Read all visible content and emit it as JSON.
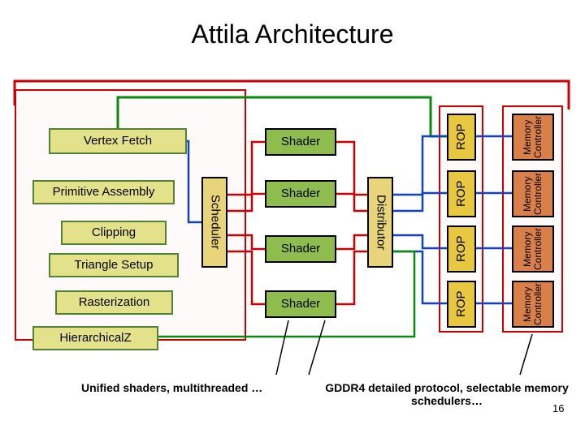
{
  "title": "Attila Architecture",
  "pipeline": {
    "vertex_fetch": "Vertex Fetch",
    "primitive_assembly": "Primitive Assembly",
    "clipping": "Clipping",
    "triangle_setup": "Triangle Setup",
    "rasterization": "Rasterization",
    "hierarchical_z": "HierarchicalZ"
  },
  "scheduler": "Scheduler",
  "distributor": "Distributor",
  "shaders": [
    "Shader",
    "Shader",
    "Shader",
    "Shader"
  ],
  "rops": [
    "ROP",
    "ROP",
    "ROP",
    "ROP"
  ],
  "memctrls": [
    "Memory Controller",
    "Memory Controller",
    "Memory Controller",
    "Memory Controller"
  ],
  "captions": {
    "left": "Unified shaders, multithreaded …",
    "right": "GDDR4 detailed protocol, selectable memory schedulers…"
  },
  "page_number": "16",
  "colors": {
    "pipeline_fill": "#e3e18a",
    "pipeline_stroke": "#538135",
    "shader_fill": "#8fbc4f",
    "scheduler_fill": "#e8d57b",
    "distributor_fill": "#e8d57b",
    "rop_fill": "#e8c840",
    "mem_fill": "#d87f4a",
    "red": "#cc0000",
    "green": "#0a8a0a",
    "blue": "#1040cc"
  }
}
